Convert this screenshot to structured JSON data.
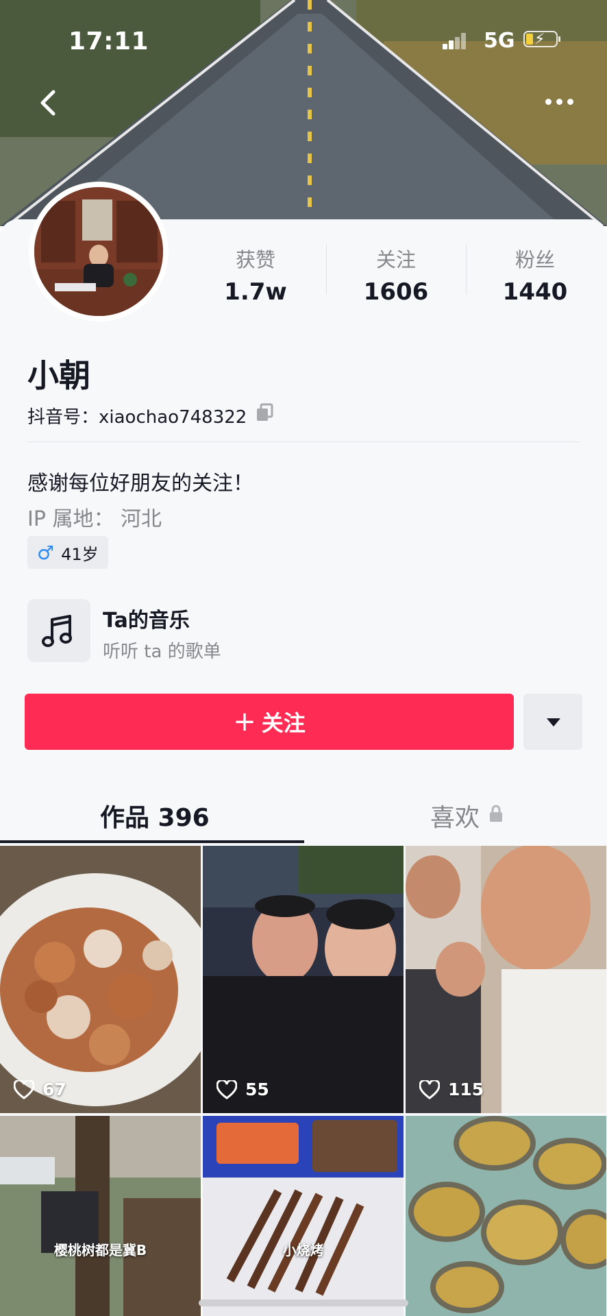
{
  "status_bar": {
    "time": "17:11",
    "network": "5G"
  },
  "profile": {
    "name": "小朝",
    "douyin_id_label": "抖音号：",
    "douyin_id": "xiaochao748322",
    "bio": "感谢每位好朋友的关注！",
    "ip_location": "IP 属地：  河北",
    "gender_icon": "♂",
    "age": "41岁"
  },
  "stats": [
    {
      "label": "获赞",
      "value": "1.7w"
    },
    {
      "label": "关注",
      "value": "1606"
    },
    {
      "label": "粉丝",
      "value": "1440"
    }
  ],
  "music": {
    "title": "Ta的音乐",
    "subtitle": "听听 ta 的歌单"
  },
  "actions": {
    "follow_label": "关注",
    "follow_plus": "+"
  },
  "tabs": {
    "works": "作品 396",
    "likes": "喜欢"
  },
  "videos": [
    {
      "likes": "67",
      "caption": ""
    },
    {
      "likes": "55",
      "caption": ""
    },
    {
      "likes": "115",
      "caption": ""
    },
    {
      "likes": "",
      "caption": "樱桃树都是冀B"
    },
    {
      "likes": "",
      "caption": "小烧烤"
    },
    {
      "likes": "",
      "caption": ""
    }
  ],
  "colors": {
    "accent": "#fe2c55",
    "text": "#161823",
    "muted": "#86878b",
    "male": "#2f8cf0"
  },
  "icons": [
    "back-icon",
    "more-icon",
    "copy-icon",
    "music-note-icon",
    "lock-icon",
    "heart-icon",
    "caret-down-icon"
  ]
}
